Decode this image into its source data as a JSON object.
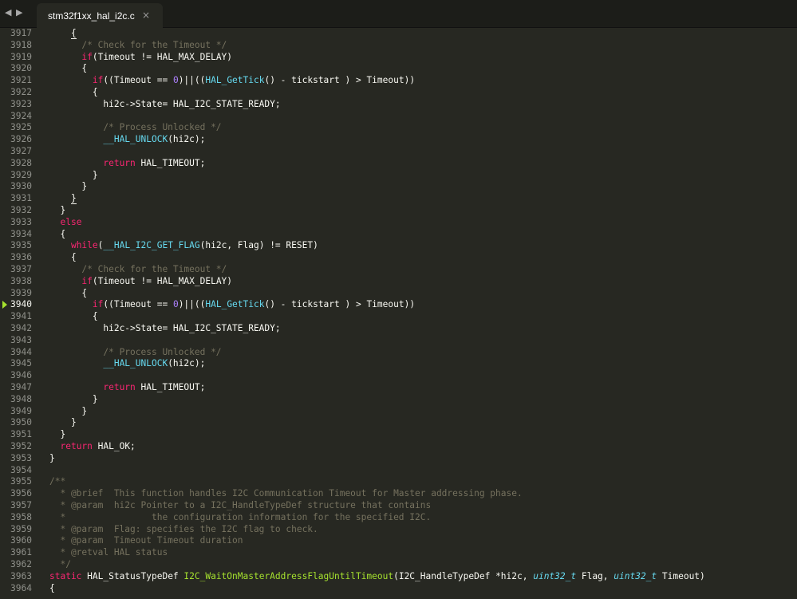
{
  "nav": {
    "back_icon": "◀",
    "forward_icon": "▶"
  },
  "tab": {
    "title": "stm32f1xx_hal_i2c.c",
    "close_icon": "×"
  },
  "colors": {
    "background": "#272822",
    "comment": "#75715e",
    "keyword": "#f92672",
    "function": "#66d9ef",
    "number": "#ae81ff",
    "definition": "#a6e22e",
    "text": "#f8f8f2"
  },
  "active_line": "3940",
  "lines": [
    {
      "n": "3917",
      "indent": "    ",
      "tokens": [
        [
          "b",
          "{"
        ]
      ]
    },
    {
      "n": "3918",
      "indent": "      ",
      "tokens": [
        [
          "c",
          "/* Check for the Timeout */"
        ]
      ]
    },
    {
      "n": "3919",
      "indent": "      ",
      "tokens": [
        [
          "k",
          "if"
        ],
        [
          "p",
          "(Timeout != HAL_MAX_DELAY)"
        ]
      ]
    },
    {
      "n": "3920",
      "indent": "      ",
      "tokens": [
        [
          "p",
          "{"
        ]
      ]
    },
    {
      "n": "3921",
      "indent": "        ",
      "tokens": [
        [
          "k",
          "if"
        ],
        [
          "p",
          "((Timeout == "
        ],
        [
          "n",
          "0"
        ],
        [
          "p",
          ")||(("
        ],
        [
          "f",
          "HAL_GetTick"
        ],
        [
          "p",
          "() - tickstart ) > Timeout))"
        ]
      ]
    },
    {
      "n": "3922",
      "indent": "        ",
      "tokens": [
        [
          "p",
          "{"
        ]
      ]
    },
    {
      "n": "3923",
      "indent": "          ",
      "tokens": [
        [
          "p",
          "hi2c->State= HAL_I2C_STATE_READY;"
        ]
      ]
    },
    {
      "n": "3924",
      "indent": "",
      "tokens": []
    },
    {
      "n": "3925",
      "indent": "          ",
      "tokens": [
        [
          "c",
          "/* Process Unlocked */"
        ]
      ]
    },
    {
      "n": "3926",
      "indent": "          ",
      "tokens": [
        [
          "f",
          "__HAL_UNLOCK"
        ],
        [
          "p",
          "(hi2c);"
        ]
      ]
    },
    {
      "n": "3927",
      "indent": "",
      "tokens": []
    },
    {
      "n": "3928",
      "indent": "          ",
      "tokens": [
        [
          "k",
          "return"
        ],
        [
          "p",
          " HAL_TIMEOUT;"
        ]
      ]
    },
    {
      "n": "3929",
      "indent": "        ",
      "tokens": [
        [
          "p",
          "}"
        ]
      ]
    },
    {
      "n": "3930",
      "indent": "      ",
      "tokens": [
        [
          "p",
          "}"
        ]
      ]
    },
    {
      "n": "3931",
      "indent": "    ",
      "tokens": [
        [
          "b",
          "}"
        ]
      ]
    },
    {
      "n": "3932",
      "indent": "  ",
      "tokens": [
        [
          "p",
          "}"
        ]
      ]
    },
    {
      "n": "3933",
      "indent": "  ",
      "tokens": [
        [
          "k",
          "else"
        ]
      ]
    },
    {
      "n": "3934",
      "indent": "  ",
      "tokens": [
        [
          "p",
          "{"
        ]
      ]
    },
    {
      "n": "3935",
      "indent": "    ",
      "tokens": [
        [
          "k",
          "while"
        ],
        [
          "p",
          "("
        ],
        [
          "f",
          "__HAL_I2C_GET_FLAG"
        ],
        [
          "p",
          "(hi2c, Flag) != RESET)"
        ]
      ]
    },
    {
      "n": "3936",
      "indent": "    ",
      "tokens": [
        [
          "p",
          "{"
        ]
      ]
    },
    {
      "n": "3937",
      "indent": "      ",
      "tokens": [
        [
          "c",
          "/* Check for the Timeout */"
        ]
      ]
    },
    {
      "n": "3938",
      "indent": "      ",
      "tokens": [
        [
          "k",
          "if"
        ],
        [
          "p",
          "(Timeout != HAL_MAX_DELAY)"
        ]
      ]
    },
    {
      "n": "3939",
      "indent": "      ",
      "tokens": [
        [
          "p",
          "{"
        ]
      ]
    },
    {
      "n": "3940",
      "indent": "        ",
      "tokens": [
        [
          "k",
          "if"
        ],
        [
          "p",
          "((Timeout == "
        ],
        [
          "n",
          "0"
        ],
        [
          "p",
          ")||(("
        ],
        [
          "f",
          "HAL_GetTick"
        ],
        [
          "p",
          "() - tickstart ) > Timeout))"
        ]
      ]
    },
    {
      "n": "3941",
      "indent": "        ",
      "tokens": [
        [
          "p",
          "{"
        ]
      ]
    },
    {
      "n": "3942",
      "indent": "          ",
      "tokens": [
        [
          "p",
          "hi2c->State= HAL_I2C_STATE_READY;"
        ]
      ]
    },
    {
      "n": "3943",
      "indent": "",
      "tokens": []
    },
    {
      "n": "3944",
      "indent": "          ",
      "tokens": [
        [
          "c",
          "/* Process Unlocked */"
        ]
      ]
    },
    {
      "n": "3945",
      "indent": "          ",
      "tokens": [
        [
          "f",
          "__HAL_UNLOCK"
        ],
        [
          "p",
          "(hi2c);"
        ]
      ]
    },
    {
      "n": "3946",
      "indent": "",
      "tokens": []
    },
    {
      "n": "3947",
      "indent": "          ",
      "tokens": [
        [
          "k",
          "return"
        ],
        [
          "p",
          " HAL_TIMEOUT;"
        ]
      ]
    },
    {
      "n": "3948",
      "indent": "        ",
      "tokens": [
        [
          "p",
          "}"
        ]
      ]
    },
    {
      "n": "3949",
      "indent": "      ",
      "tokens": [
        [
          "p",
          "}"
        ]
      ]
    },
    {
      "n": "3950",
      "indent": "    ",
      "tokens": [
        [
          "p",
          "}"
        ]
      ]
    },
    {
      "n": "3951",
      "indent": "  ",
      "tokens": [
        [
          "p",
          "}"
        ]
      ]
    },
    {
      "n": "3952",
      "indent": "  ",
      "tokens": [
        [
          "k",
          "return"
        ],
        [
          "p",
          " HAL_OK;"
        ]
      ]
    },
    {
      "n": "3953",
      "indent": "",
      "tokens": [
        [
          "p",
          "}"
        ]
      ]
    },
    {
      "n": "3954",
      "indent": "",
      "tokens": []
    },
    {
      "n": "3955",
      "indent": "",
      "tokens": [
        [
          "c",
          "/**"
        ]
      ]
    },
    {
      "n": "3956",
      "indent": "",
      "tokens": [
        [
          "c",
          "  * @brief  This function handles I2C Communication Timeout for Master addressing phase."
        ]
      ]
    },
    {
      "n": "3957",
      "indent": "",
      "tokens": [
        [
          "c",
          "  * @param  hi2c Pointer to a I2C_HandleTypeDef structure that contains"
        ]
      ]
    },
    {
      "n": "3958",
      "indent": "",
      "tokens": [
        [
          "c",
          "  *                the configuration information for the specified I2C."
        ]
      ]
    },
    {
      "n": "3959",
      "indent": "",
      "tokens": [
        [
          "c",
          "  * @param  Flag: specifies the I2C flag to check."
        ]
      ]
    },
    {
      "n": "3960",
      "indent": "",
      "tokens": [
        [
          "c",
          "  * @param  Timeout Timeout duration"
        ]
      ]
    },
    {
      "n": "3961",
      "indent": "",
      "tokens": [
        [
          "c",
          "  * @retval HAL status"
        ]
      ]
    },
    {
      "n": "3962",
      "indent": "",
      "tokens": [
        [
          "c",
          "  */"
        ]
      ]
    },
    {
      "n": "3963",
      "indent": "",
      "tokens": [
        [
          "k",
          "static"
        ],
        [
          "p",
          " HAL_StatusTypeDef "
        ],
        [
          "d",
          "I2C_WaitOnMasterAddressFlagUntilTimeout"
        ],
        [
          "p",
          "(I2C_HandleTypeDef *hi2c, "
        ],
        [
          "t",
          "uint32_t"
        ],
        [
          "p",
          " Flag, "
        ],
        [
          "t",
          "uint32_t"
        ],
        [
          "p",
          " Timeout)"
        ]
      ]
    },
    {
      "n": "3964",
      "indent": "",
      "tokens": [
        [
          "p",
          "{"
        ]
      ]
    }
  ]
}
